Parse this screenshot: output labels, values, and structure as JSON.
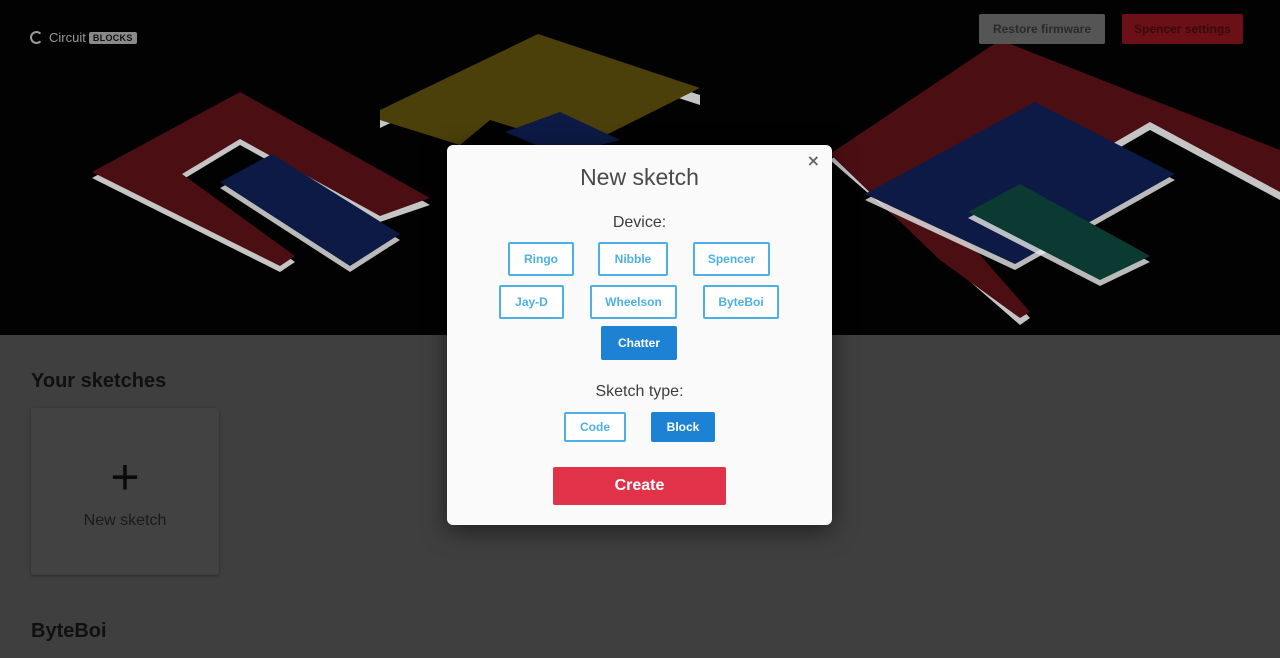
{
  "header": {
    "logo_text": "Circuit",
    "logo_badge": "BLOCKS",
    "restore_firmware_label": "Restore firmware",
    "settings_label": "Spencer settings"
  },
  "main": {
    "your_sketches_title": "Your sketches",
    "new_sketch_plus": "+",
    "new_sketch_label": "New sketch",
    "byteboi_title": "ByteBoi"
  },
  "modal": {
    "title": "New sketch",
    "close": "×",
    "device_label": "Device:",
    "devices": [
      "Ringo",
      "Nibble",
      "Spencer",
      "Jay-D",
      "Wheelson",
      "ByteBoi",
      "Chatter"
    ],
    "selected_device": "Chatter",
    "sketch_type_label": "Sketch type:",
    "sketch_types": [
      "Code",
      "Block"
    ],
    "selected_sketch_type": "Block",
    "create_label": "Create"
  },
  "colors": {
    "accent": "#1d82d4",
    "accent_outline": "#4cb0e6",
    "create": "#e03349"
  }
}
